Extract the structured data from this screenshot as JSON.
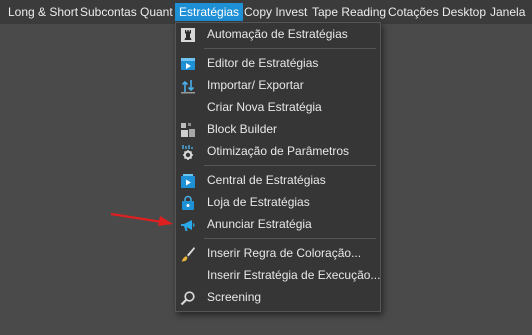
{
  "menubar": {
    "items": [
      {
        "label": "Long & Short"
      },
      {
        "label": "Subcontas"
      },
      {
        "label": "Quant"
      },
      {
        "label": "Estratégias"
      },
      {
        "label": "Copy Invest"
      },
      {
        "label": "Tape Reading"
      },
      {
        "label": "Cotações"
      },
      {
        "label": "Desktop"
      },
      {
        "label": "Janela"
      }
    ],
    "active_index": 3
  },
  "dropdown": {
    "items": [
      {
        "label": "Automação de Estratégias",
        "icon": "chess-rook-icon"
      },
      {
        "label": "Editor de Estratégias",
        "icon": "editor-icon"
      },
      {
        "label": "Importar/ Exportar",
        "icon": "import-export-icon"
      },
      {
        "label": "Criar Nova Estratégia",
        "icon": ""
      },
      {
        "label": "Block Builder",
        "icon": "block-builder-icon"
      },
      {
        "label": "Otimização de Parâmetros",
        "icon": "optimization-icon"
      },
      {
        "label": "Central de Estratégias",
        "icon": "strategy-center-icon"
      },
      {
        "label": "Loja de Estratégias",
        "icon": "shopping-bag-icon"
      },
      {
        "label": "Anunciar Estratégia",
        "icon": "megaphone-icon"
      },
      {
        "label": "Inserir Regra de Coloração...",
        "icon": "paint-brush-icon"
      },
      {
        "label": "Inserir Estratégia de Execução...",
        "icon": ""
      },
      {
        "label": "Screening",
        "icon": "search-icon"
      }
    ]
  },
  "colors": {
    "accent": "#1e90d6",
    "menu_bg": "#363636",
    "annotation_arrow": "#e02020"
  }
}
